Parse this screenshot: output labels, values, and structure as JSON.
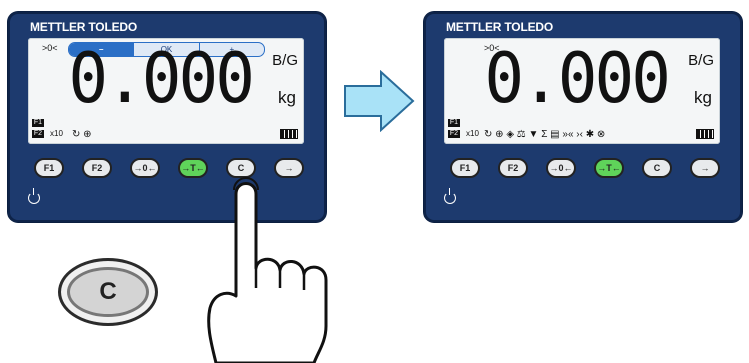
{
  "brand": "METTLER TOLEDO",
  "left_panel": {
    "zero_indicator": ">0<",
    "softkeys": [
      "–",
      "OK",
      "+"
    ],
    "readout": "0.000",
    "unit_mode": "B/G",
    "unit": "kg",
    "f1": "F1",
    "f2": "F2",
    "multiplier": "x10"
  },
  "right_panel": {
    "zero_indicator": ">0<",
    "readout": "0.000",
    "unit_mode": "B/G",
    "unit": "kg",
    "f1": "F1",
    "f2": "F2",
    "multiplier": "x10"
  },
  "keys": [
    "F1",
    "F2",
    "→0←",
    "→T←",
    "C",
    "→"
  ],
  "big_key_label": "C",
  "colors": {
    "panel": "#1d3a6e",
    "lcd": "#f4f6f7",
    "accent": "#2b6fc6",
    "tare_key": "#5fd35a"
  }
}
